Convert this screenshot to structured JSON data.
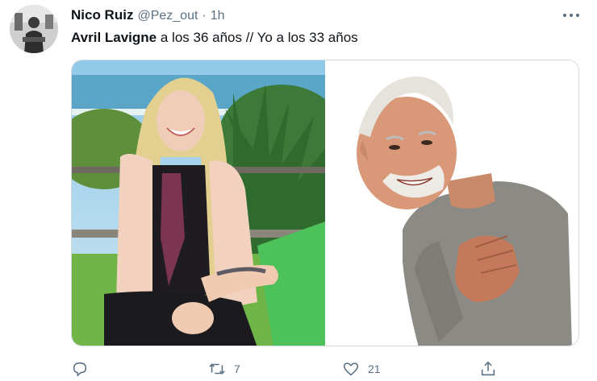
{
  "tweet": {
    "author": {
      "display_name": "Nico Ruiz",
      "handle": "@Pez_out",
      "separator": "·",
      "time": "1h"
    },
    "text": {
      "bold_part": "Avril Lavigne",
      "rest": " a los 36 años // Yo a los 33 años"
    },
    "actions": {
      "reply_count": "",
      "retweet_count": "7",
      "like_count": "21",
      "share_count": ""
    },
    "icons": {
      "more": "more-horizontal-icon",
      "reply": "reply-icon",
      "retweet": "retweet-icon",
      "like": "heart-icon",
      "share": "share-icon"
    },
    "colors": {
      "primary_text": "#0f1419",
      "secondary_text": "#5b7083",
      "border": "#cfd9de"
    }
  }
}
